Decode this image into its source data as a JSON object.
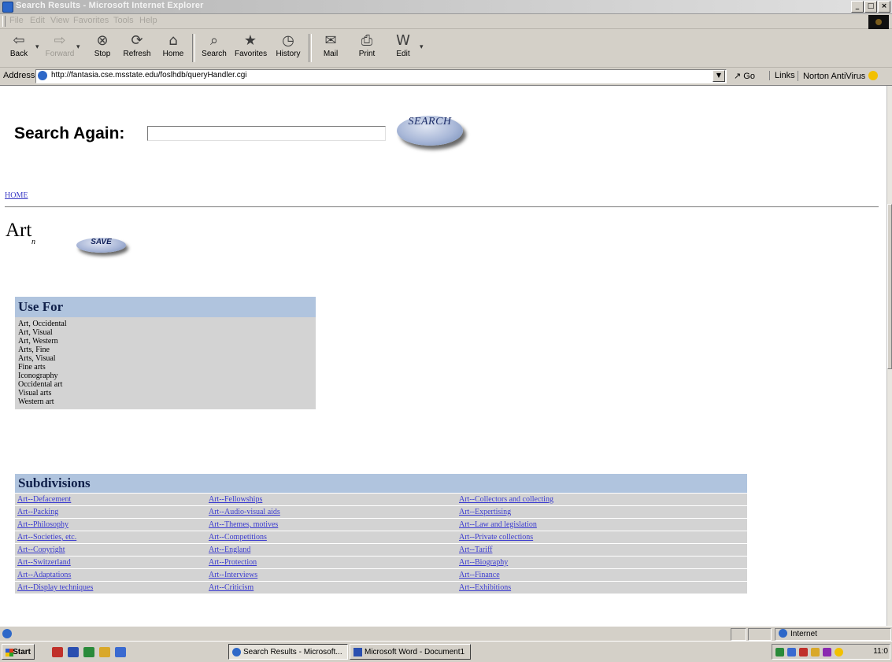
{
  "window": {
    "title": "Search Results - Microsoft Internet Explorer",
    "buttons": [
      "_",
      "□",
      "×"
    ]
  },
  "menu": [
    "File",
    "Edit",
    "View",
    "Favorites",
    "Tools",
    "Help"
  ],
  "toolbar": {
    "back": "Back",
    "forward": "Forward",
    "stop": "Stop",
    "refresh": "Refresh",
    "home": "Home",
    "search": "Search",
    "favorites": "Favorites",
    "history": "History",
    "mail": "Mail",
    "print": "Print",
    "edit": "Edit"
  },
  "address": {
    "label": "Address",
    "url": "http://fantasia.cse.msstate.edu/foslhdb/queryHandler.cgi",
    "go": "Go",
    "links": "Links",
    "norton": "Norton AntiVirus"
  },
  "search": {
    "label": "Search Again:",
    "value": "",
    "button": "SEARCH"
  },
  "nav": {
    "home": "HOME"
  },
  "term": {
    "title": "Art",
    "sub": "n",
    "save": "SAVE"
  },
  "use_for": {
    "header": "Use For",
    "items": [
      "Art, Occidental",
      "Art, Visual",
      "Art, Western",
      "Arts, Fine",
      "Arts, Visual",
      "Fine arts",
      "Iconography",
      "Occidental art",
      "Visual arts",
      "Western art"
    ]
  },
  "subdivisions": {
    "header": "Subdivisions",
    "rows": [
      [
        "Art--Defacement",
        "Art--Fellowships",
        "Art--Collectors and collecting"
      ],
      [
        "Art--Packing",
        "Art--Audio-visual aids",
        "Art--Expertising"
      ],
      [
        "Art--Philosophy",
        "Art--Themes, motives",
        "Art--Law and legislation"
      ],
      [
        "Art--Societies, etc.",
        "Art--Competitions",
        "Art--Private collections"
      ],
      [
        "Art--Copyright",
        "Art--England",
        "Art--Tariff"
      ],
      [
        "Art--Switzerland",
        "Art--Protection",
        "Art--Biography"
      ],
      [
        "Art--Adaptations",
        "Art--Interviews",
        "Art--Finance"
      ],
      [
        "Art--Display techniques",
        "Art--Criticism",
        "Art--Exhibitions"
      ]
    ]
  },
  "status": {
    "zone": "Internet"
  },
  "taskbar": {
    "start": "Start",
    "tasks": [
      "Search Results - Microsoft...",
      "Microsoft Word - Document1"
    ],
    "clock": "11:0"
  }
}
